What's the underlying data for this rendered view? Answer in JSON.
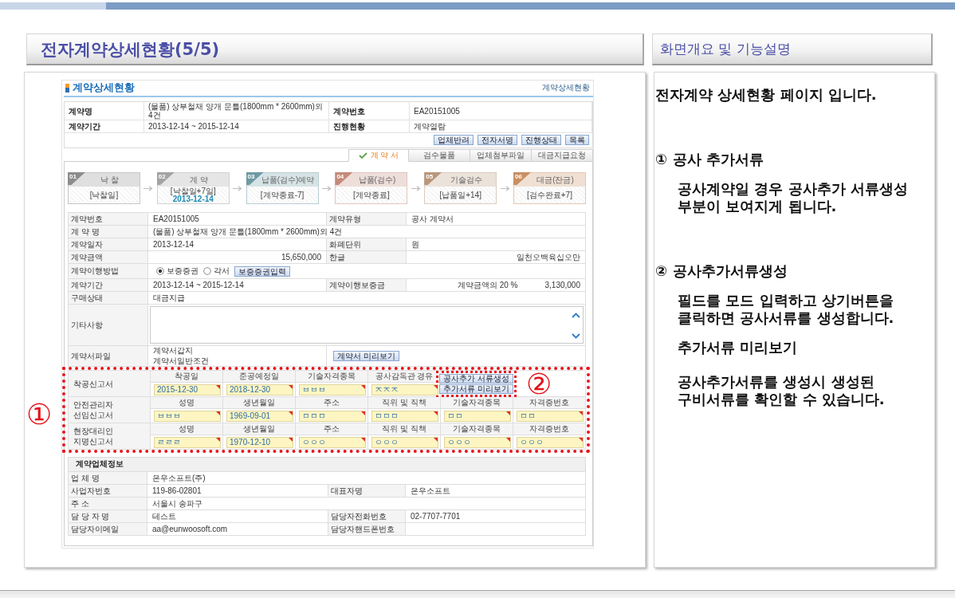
{
  "slide_title": "전자계약상세현황(5/5)",
  "contract_page": {
    "title": "계약상세현황",
    "breadcrumb": "계약상세현황",
    "summary": [
      {
        "label": "계약명",
        "value": "(물품) 상부철재 양개 문틀(1800mm * 2600mm)외 4건"
      },
      {
        "label": "계약번호",
        "value": "EA20151005"
      },
      {
        "label": "계약기간",
        "value": "2013-12-14 ~ 2015-12-14"
      },
      {
        "label": "진행현황",
        "value": "계약열람"
      }
    ],
    "actions": [
      "업체반려",
      "전자서명",
      "진행상태",
      "목록"
    ],
    "tabs": [
      {
        "label": "계 약 서",
        "selected": true
      },
      {
        "label": "검수물품",
        "selected": false
      },
      {
        "label": "업체첨부파일",
        "selected": false
      },
      {
        "label": "대금지급요청",
        "selected": false
      }
    ],
    "steps": [
      {
        "number": "01",
        "title": "낙 찰",
        "note": "[낙찰일]",
        "color": "#8c8c8c"
      },
      {
        "number": "02",
        "title": "계 약",
        "note": "[낙찰일+7일]",
        "date": "2013-12-14",
        "color": "#a3a3a3"
      },
      {
        "number": "03",
        "title": "납품(검수)예약",
        "note": "[계약종료-7]",
        "color": "#6e9aa3"
      },
      {
        "number": "04",
        "title": "납품(검수)",
        "note": "[계약종료]",
        "color": "#c48a7a"
      },
      {
        "number": "05",
        "title": "기술검수",
        "note": "[납품일+14]",
        "color": "#b8977a"
      },
      {
        "number": "06",
        "title": "대금(잔금)",
        "note": "[검수완료+7]",
        "color": "#c98f62"
      }
    ],
    "details": [
      {
        "kind": "pair",
        "cells": [
          {
            "label": "계약번호",
            "value": "EA20151005"
          },
          {
            "label": "계약유형",
            "value": "공사 계약서"
          }
        ]
      },
      {
        "kind": "single",
        "label": "계 약 명",
        "value": "(물품) 상부철재 양개 문틀(1800mm * 2600mm)외 4건"
      },
      {
        "kind": "pair",
        "cells": [
          {
            "label": "계약일자",
            "value": "2013-12-14"
          },
          {
            "label": "화폐단위",
            "value": "원"
          }
        ]
      },
      {
        "kind": "amount",
        "cells": [
          {
            "label": "계약금액",
            "value": "15,650,000"
          },
          {
            "label": "한글",
            "value": "일천오백육십오만"
          }
        ]
      },
      {
        "kind": "method",
        "label": "계약이행방법",
        "options": [
          {
            "label": "보증증권",
            "selected": true
          },
          {
            "label": "각서",
            "selected": false
          }
        ],
        "button": "보증증권입력"
      },
      {
        "kind": "pair",
        "cells": [
          {
            "label": "계약기간",
            "value": "2013-12-14 ~ 2015-12-14"
          },
          {
            "label": "계약이행보증금",
            "value": "계약금액의 20 %",
            "amount": "3,130,000"
          }
        ]
      },
      {
        "kind": "single",
        "label": "구매상태",
        "value": "대금지급"
      },
      {
        "kind": "notes",
        "label": "기타사항"
      },
      {
        "kind": "files",
        "label": "계약서파일",
        "files": [
          "계약서갑지",
          "계약서일반조건"
        ],
        "button": "계약서 미리보기"
      }
    ],
    "construction": {
      "marker": "①",
      "forms": [
        {
          "name": "착공신고서",
          "fields": [
            {
              "label": "착공일",
              "value": "2015-12-30"
            },
            {
              "label": "준공예정일",
              "value": "2018-12-30"
            },
            {
              "label": "기술자격종목",
              "value": "ㅂㅂㅂ"
            },
            {
              "label": "공사감독관 경유",
              "value": "ㅈㅈㅈ"
            }
          ],
          "action_group": {
            "marker": "②",
            "buttons": [
              "공사추가 서류생성",
              "추가서류 미리보기"
            ]
          }
        },
        {
          "name": "안전관리자 선임신고서",
          "fields": [
            {
              "label": "성명",
              "value": "ㅂㅂㅂ"
            },
            {
              "label": "생년월일",
              "value": "1969-09-01"
            },
            {
              "label": "주소",
              "value": "ㅁㅁㅁ"
            },
            {
              "label": "직위 및 직책",
              "value": "ㅁㅁㅁ"
            },
            {
              "label": "기술자격종목",
              "value": "ㅁㅁ"
            },
            {
              "label": "자격증번호",
              "value": "ㅁㅁ"
            }
          ]
        },
        {
          "name": "현장대리인 지명신고서",
          "fields": [
            {
              "label": "성명",
              "value": "ㄹㄹㄹ"
            },
            {
              "label": "생년월일",
              "value": "1970-12-10"
            },
            {
              "label": "주소",
              "value": "ㅇㅇㅇ"
            },
            {
              "label": "직위 및 직책",
              "value": "ㅇㅇㅇ"
            },
            {
              "label": "기술자격종목",
              "value": "ㅇㅇㅇ"
            },
            {
              "label": "자격증번호",
              "value": "ㅇㅇㅇ"
            }
          ]
        }
      ]
    },
    "company": {
      "title": "계약업체정보",
      "rows": [
        {
          "kind": "single",
          "label": "업 체 명",
          "value": "은우소프트(주)"
        },
        {
          "kind": "pair",
          "cells": [
            {
              "label": "사업자번호",
              "value": "119-86-02801"
            },
            {
              "label": "대표자명",
              "value": "은우소프트"
            }
          ]
        },
        {
          "kind": "single",
          "label": "주 소",
          "value": "서울시 송파구"
        },
        {
          "kind": "pair",
          "cells": [
            {
              "label": "담 당 자 명",
              "value": "테스트"
            },
            {
              "label": "담당자전화번호",
              "value": "02-7707-7701"
            }
          ]
        },
        {
          "kind": "pair",
          "cells": [
            {
              "label": "담당자이메일",
              "value": "aa@eunwoosoft.com"
            },
            {
              "label": "담당자핸드폰번호"
            }
          ]
        }
      ]
    }
  },
  "description": {
    "title": "화면개요 및 기능설명",
    "blocks": [
      {
        "kind": "intro",
        "text": "전자계약 상세현황 페이지 입니다."
      },
      {
        "kind": "heading",
        "text": "① 공사 추가서류"
      },
      {
        "kind": "paragraph",
        "text": "공사계약일 경우 공사추가 서류생성 부분이 보여지게 됩니다."
      },
      {
        "kind": "heading",
        "text": "② 공사추가서류생성"
      },
      {
        "kind": "paragraph",
        "text": "필드를 모드 입력하고 상기버튼을 클릭하면 공사서류를 생성합니다."
      },
      {
        "kind": "subheading",
        "text": "추가서류 미리보기"
      },
      {
        "kind": "paragraph",
        "text": "공사추가서류를 생성시 생성된 구비서류를 확인할 수 있습니다."
      }
    ]
  }
}
